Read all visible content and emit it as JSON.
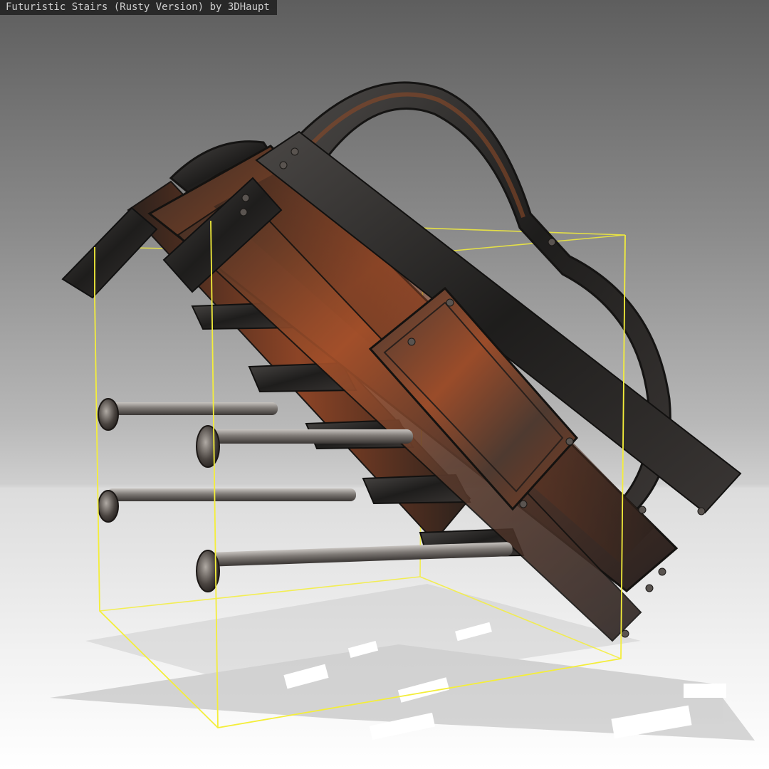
{
  "viewer": {
    "title": "Futuristic Stairs (Rusty Version) by 3DHaupt"
  },
  "scene": {
    "object": "futuristic-stairs-rusty",
    "bounding_box_color": "#f4ee3a",
    "rust_color": "#b5562a",
    "metal_dark_color": "#2c2a28",
    "bar_color": "#8e8a86"
  }
}
